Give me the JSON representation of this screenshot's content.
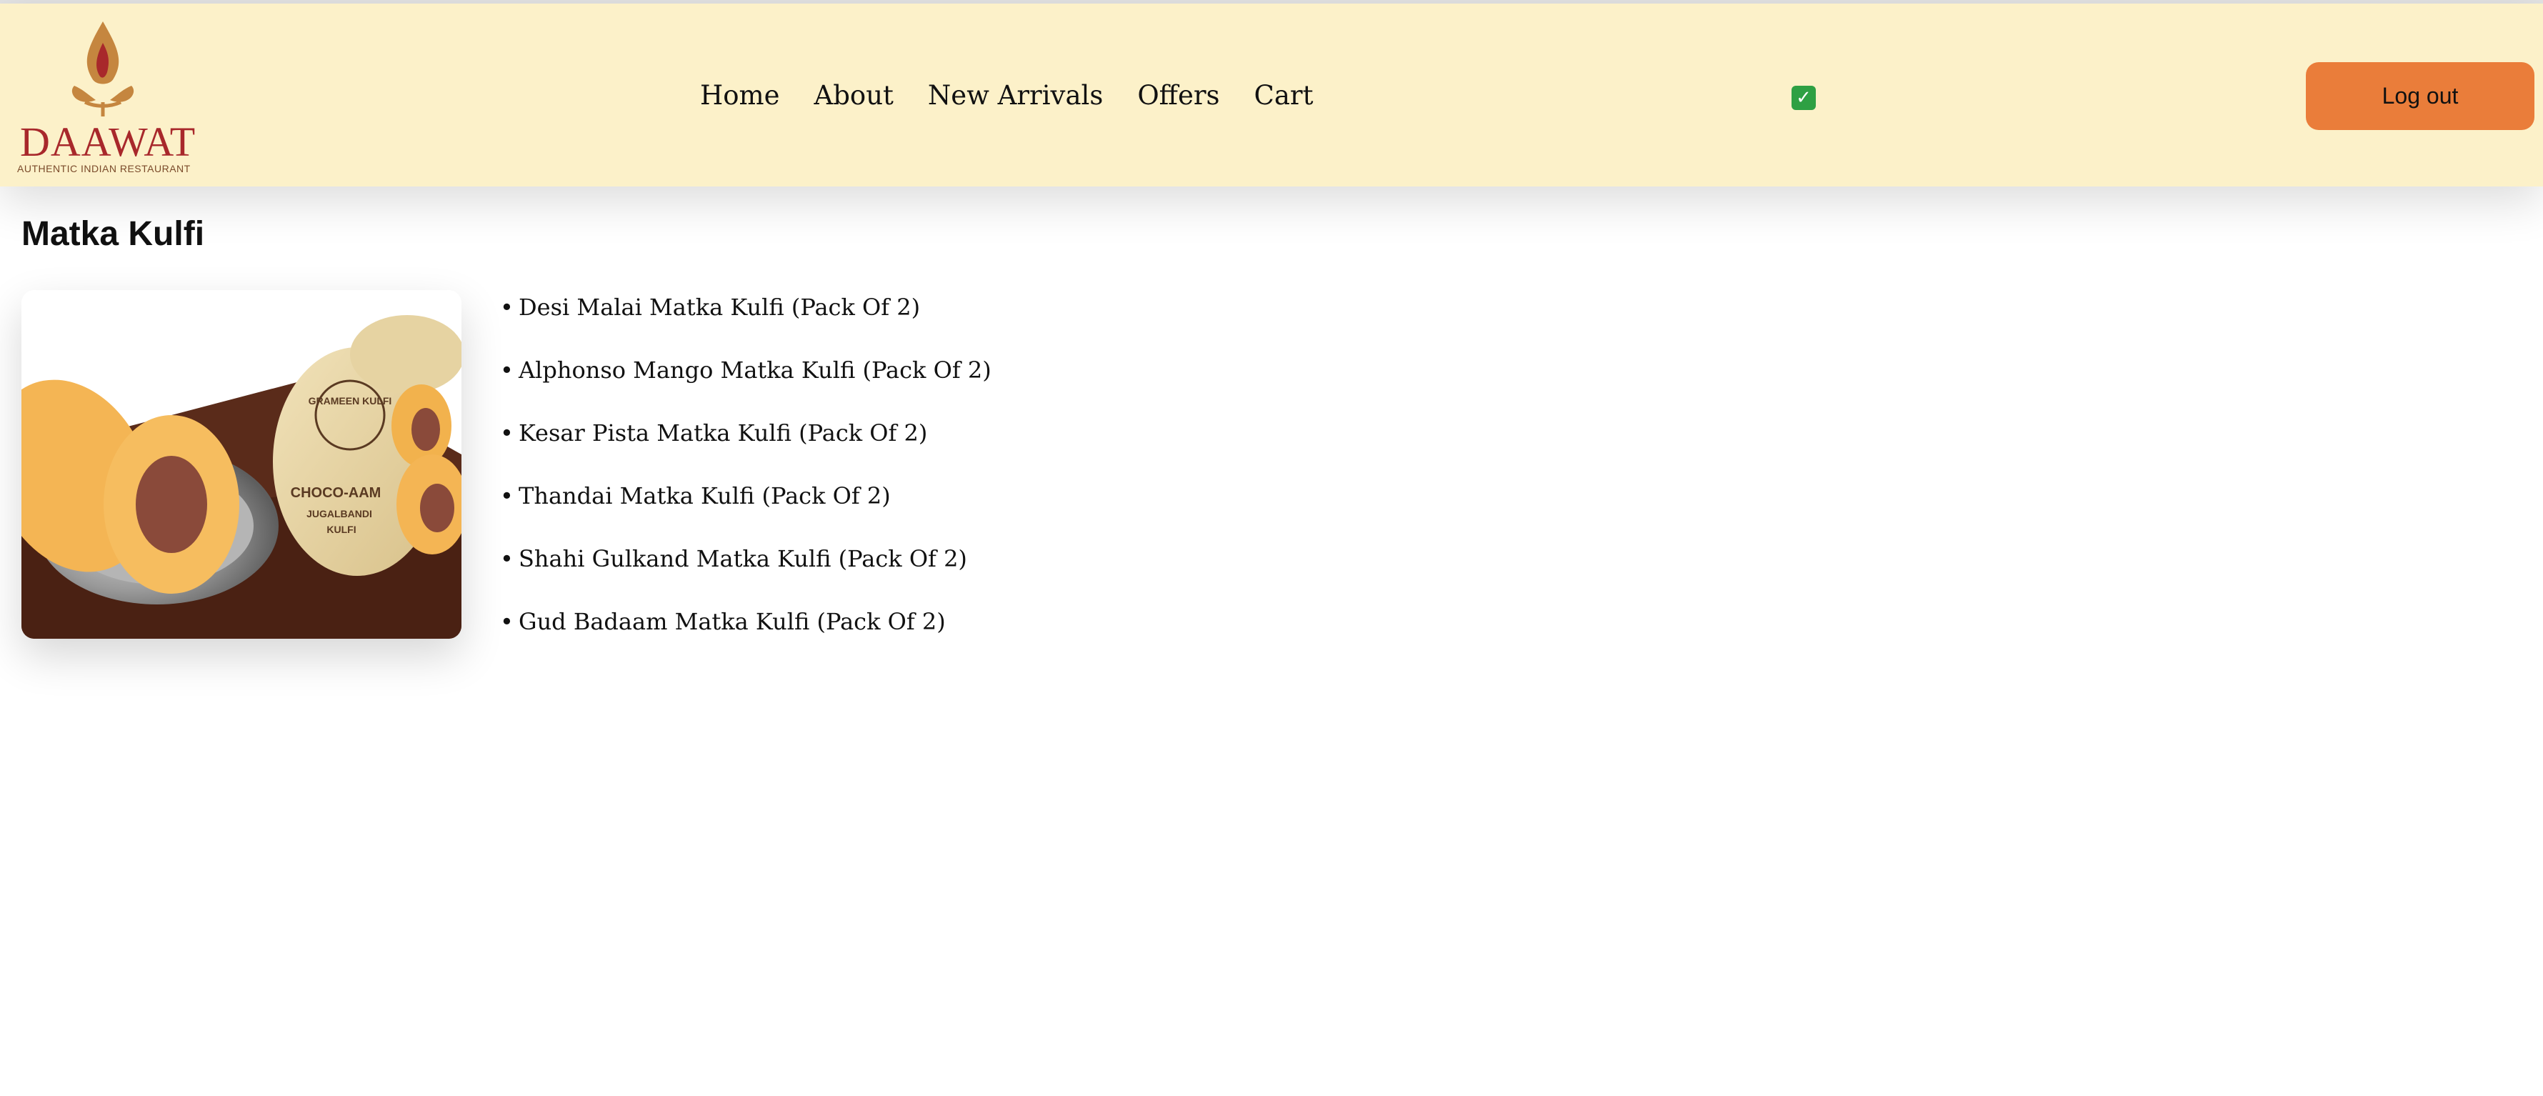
{
  "logo": {
    "name": "DAAWAT",
    "tagline": "AUTHENTIC INDIAN RESTAURANT"
  },
  "nav": {
    "items": [
      "Home",
      "About",
      "New Arrivals",
      "Offers",
      "Cart"
    ]
  },
  "status": {
    "icon": "check-mark-button-icon",
    "glyph": "✓",
    "color": "#2ea043"
  },
  "header": {
    "logout_label": "Log out",
    "background": "#fcf1c9",
    "button_color": "#ea7d3a"
  },
  "page": {
    "title": "Matka Kulfi"
  },
  "product_image": {
    "tub_brand": "GRAMEEN KULFI",
    "tub_flavor": "CHOCO-AAM",
    "tub_sub1": "JUGALBANDI",
    "tub_sub2": "KULFI"
  },
  "products": [
    "Desi Malai Matka Kulfi (Pack Of 2)",
    "Alphonso Mango Matka Kulfi (Pack Of 2)",
    "Kesar Pista Matka Kulfi (Pack Of 2)",
    "Thandai Matka Kulfi (Pack Of 2)",
    "Shahi Gulkand Matka Kulfi (Pack Of 2)",
    "Gud Badaam Matka Kulfi (Pack Of 2)"
  ]
}
